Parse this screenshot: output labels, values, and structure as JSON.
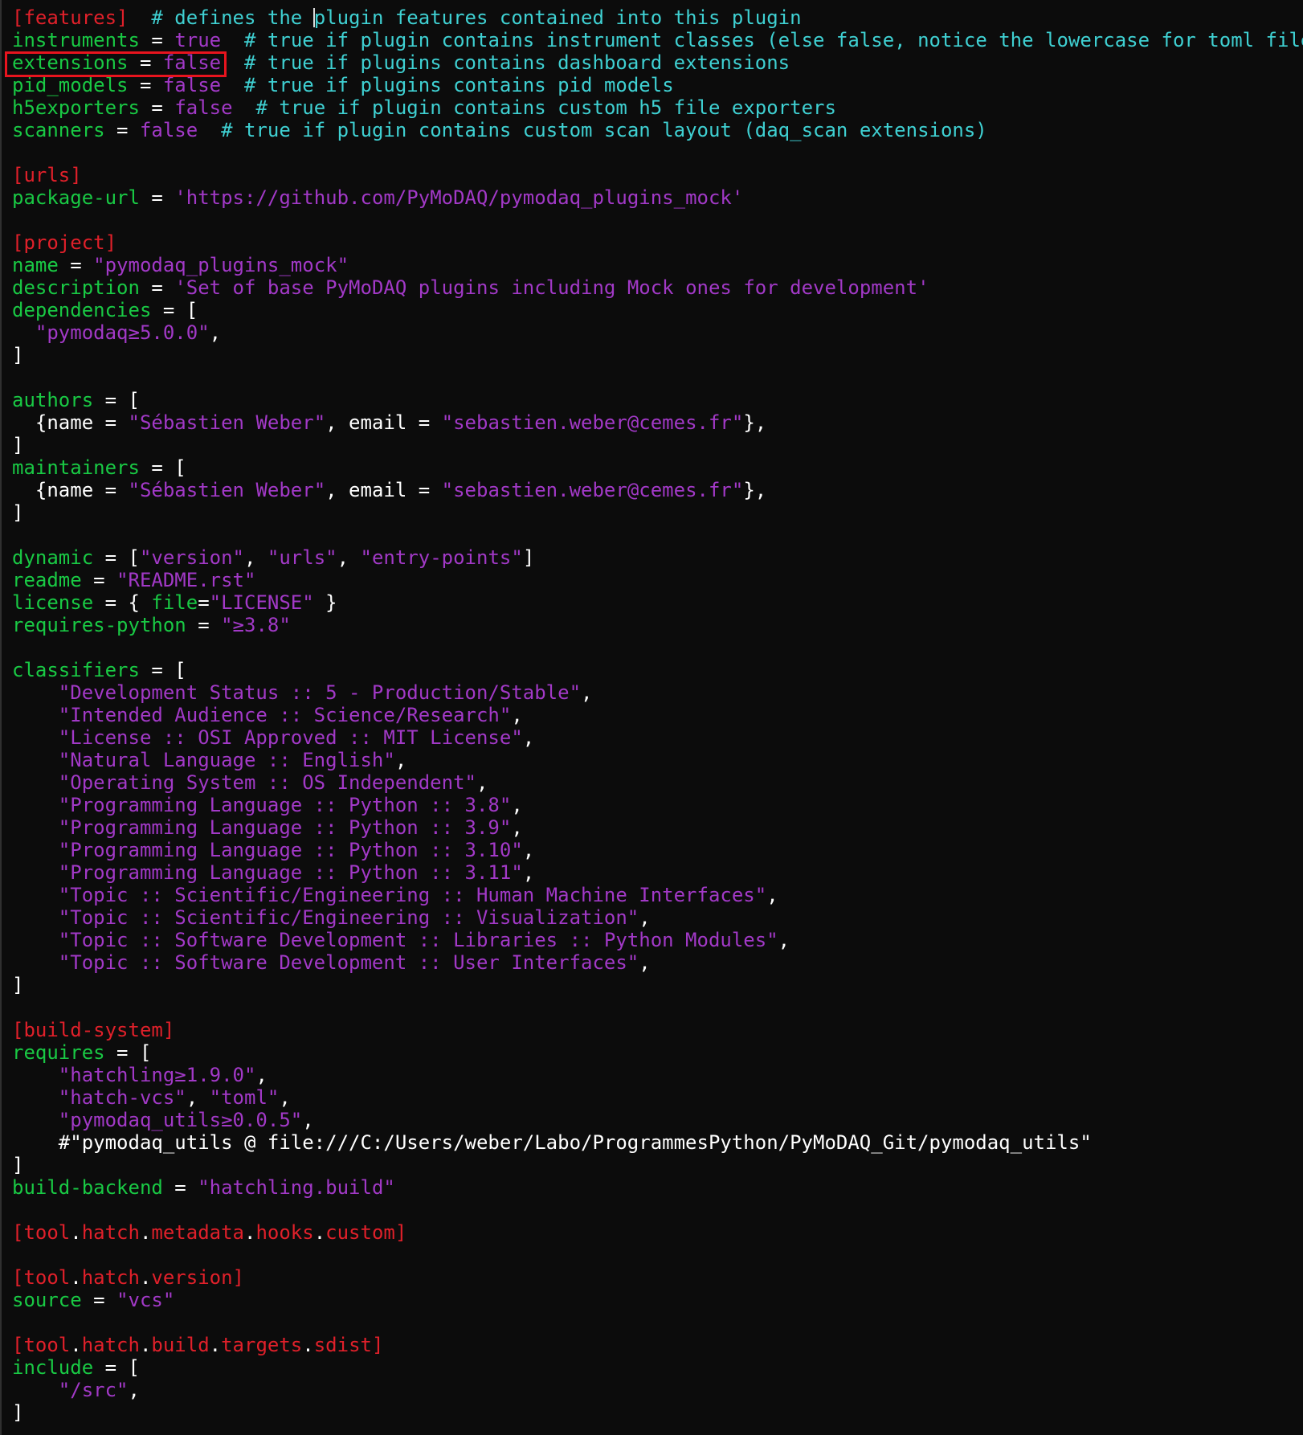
{
  "colors": {
    "background": "#0c0c0c",
    "section": "#e0202a",
    "key": "#19c944",
    "string": "#a239c7",
    "comment": "#3fd0d2",
    "punctuation": "#ffffff",
    "highlight_box": "#e8141e"
  },
  "lines": [
    [
      {
        "t": "[features]",
        "c": "section"
      },
      {
        "t": "  ",
        "c": "punc"
      },
      {
        "t": "# defines the ",
        "c": "comment"
      },
      {
        "cursor": true
      },
      {
        "t": "plugin features contained into this plugin",
        "c": "comment"
      }
    ],
    [
      {
        "t": "instruments",
        "c": "key"
      },
      {
        "t": " = ",
        "c": "punc"
      },
      {
        "t": "true",
        "c": "str"
      },
      {
        "t": "  ",
        "c": "punc"
      },
      {
        "t": "# true if plugin contains instrument classes (else false, notice the lowercase for toml files)",
        "c": "comment"
      }
    ],
    [
      {
        "t": "extensions",
        "c": "key"
      },
      {
        "t": " = ",
        "c": "punc"
      },
      {
        "t": "false",
        "c": "str"
      },
      {
        "t": "  ",
        "c": "punc"
      },
      {
        "t": "# true if plugins contains dashboard extensions",
        "c": "comment"
      }
    ],
    [
      {
        "t": "pid_models",
        "c": "key"
      },
      {
        "t": " = ",
        "c": "punc"
      },
      {
        "t": "false",
        "c": "str"
      },
      {
        "t": "  ",
        "c": "punc"
      },
      {
        "t": "# true if plugins contains pid models",
        "c": "comment"
      }
    ],
    [
      {
        "t": "h5exporters",
        "c": "key"
      },
      {
        "t": " = ",
        "c": "punc"
      },
      {
        "t": "false",
        "c": "str"
      },
      {
        "t": "  ",
        "c": "punc"
      },
      {
        "t": "# true if plugin contains custom h5 file exporters",
        "c": "comment"
      }
    ],
    [
      {
        "t": "scanners",
        "c": "key"
      },
      {
        "t": " = ",
        "c": "punc"
      },
      {
        "t": "false",
        "c": "str"
      },
      {
        "t": "  ",
        "c": "punc"
      },
      {
        "t": "# true if plugin contains custom scan layout (daq_scan extensions)",
        "c": "comment"
      }
    ],
    [],
    [
      {
        "t": "[urls]",
        "c": "section"
      }
    ],
    [
      {
        "t": "package-url",
        "c": "key"
      },
      {
        "t": " = ",
        "c": "punc"
      },
      {
        "t": "'https://github.com/PyMoDAQ/pymodaq_plugins_mock'",
        "c": "str"
      }
    ],
    [],
    [
      {
        "t": "[project]",
        "c": "section"
      }
    ],
    [
      {
        "t": "name",
        "c": "key"
      },
      {
        "t": " = ",
        "c": "punc"
      },
      {
        "t": "\"pymodaq_plugins_mock\"",
        "c": "str"
      }
    ],
    [
      {
        "t": "description",
        "c": "key"
      },
      {
        "t": " = ",
        "c": "punc"
      },
      {
        "t": "'Set of base PyMoDAQ plugins including Mock ones for development'",
        "c": "str"
      }
    ],
    [
      {
        "t": "dependencies",
        "c": "key"
      },
      {
        "t": " = [",
        "c": "punc"
      }
    ],
    [
      {
        "t": "  ",
        "c": "punc"
      },
      {
        "t": "\"pymodaq≥5.0.0\"",
        "c": "str"
      },
      {
        "t": ",",
        "c": "punc"
      }
    ],
    [
      {
        "t": "]",
        "c": "punc"
      }
    ],
    [],
    [
      {
        "t": "authors",
        "c": "key"
      },
      {
        "t": " = [",
        "c": "punc"
      }
    ],
    [
      {
        "t": "  {name = ",
        "c": "punc"
      },
      {
        "t": "\"Sébastien Weber\"",
        "c": "str"
      },
      {
        "t": ", email = ",
        "c": "punc"
      },
      {
        "t": "\"sebastien.weber@cemes.fr\"",
        "c": "str"
      },
      {
        "t": "},",
        "c": "punc"
      }
    ],
    [
      {
        "t": "]",
        "c": "punc"
      }
    ],
    [
      {
        "t": "maintainers",
        "c": "key"
      },
      {
        "t": " = [",
        "c": "punc"
      }
    ],
    [
      {
        "t": "  {name = ",
        "c": "punc"
      },
      {
        "t": "\"Sébastien Weber\"",
        "c": "str"
      },
      {
        "t": ", email = ",
        "c": "punc"
      },
      {
        "t": "\"sebastien.weber@cemes.fr\"",
        "c": "str"
      },
      {
        "t": "},",
        "c": "punc"
      }
    ],
    [
      {
        "t": "]",
        "c": "punc"
      }
    ],
    [],
    [
      {
        "t": "dynamic",
        "c": "key"
      },
      {
        "t": " = [",
        "c": "punc"
      },
      {
        "t": "\"version\"",
        "c": "str"
      },
      {
        "t": ", ",
        "c": "punc"
      },
      {
        "t": "\"urls\"",
        "c": "str"
      },
      {
        "t": ", ",
        "c": "punc"
      },
      {
        "t": "\"entry-points\"",
        "c": "str"
      },
      {
        "t": "]",
        "c": "punc"
      }
    ],
    [
      {
        "t": "readme",
        "c": "key"
      },
      {
        "t": " = ",
        "c": "punc"
      },
      {
        "t": "\"README.rst\"",
        "c": "str"
      }
    ],
    [
      {
        "t": "license",
        "c": "key"
      },
      {
        "t": " = { ",
        "c": "punc"
      },
      {
        "t": "file",
        "c": "key"
      },
      {
        "t": "=",
        "c": "punc"
      },
      {
        "t": "\"LICENSE\"",
        "c": "str"
      },
      {
        "t": " }",
        "c": "punc"
      }
    ],
    [
      {
        "t": "requires-python",
        "c": "key"
      },
      {
        "t": " = ",
        "c": "punc"
      },
      {
        "t": "\"≥3.8\"",
        "c": "str"
      }
    ],
    [],
    [
      {
        "t": "classifiers",
        "c": "key"
      },
      {
        "t": " = [",
        "c": "punc"
      }
    ],
    [
      {
        "t": "    ",
        "c": "punc"
      },
      {
        "t": "\"Development Status :: 5 - Production/Stable\"",
        "c": "str"
      },
      {
        "t": ",",
        "c": "punc"
      }
    ],
    [
      {
        "t": "    ",
        "c": "punc"
      },
      {
        "t": "\"Intended Audience :: Science/Research\"",
        "c": "str"
      },
      {
        "t": ",",
        "c": "punc"
      }
    ],
    [
      {
        "t": "    ",
        "c": "punc"
      },
      {
        "t": "\"License :: OSI Approved :: MIT License\"",
        "c": "str"
      },
      {
        "t": ",",
        "c": "punc"
      }
    ],
    [
      {
        "t": "    ",
        "c": "punc"
      },
      {
        "t": "\"Natural Language :: English\"",
        "c": "str"
      },
      {
        "t": ",",
        "c": "punc"
      }
    ],
    [
      {
        "t": "    ",
        "c": "punc"
      },
      {
        "t": "\"Operating System :: OS Independent\"",
        "c": "str"
      },
      {
        "t": ",",
        "c": "punc"
      }
    ],
    [
      {
        "t": "    ",
        "c": "punc"
      },
      {
        "t": "\"Programming Language :: Python :: 3.8\"",
        "c": "str"
      },
      {
        "t": ",",
        "c": "punc"
      }
    ],
    [
      {
        "t": "    ",
        "c": "punc"
      },
      {
        "t": "\"Programming Language :: Python :: 3.9\"",
        "c": "str"
      },
      {
        "t": ",",
        "c": "punc"
      }
    ],
    [
      {
        "t": "    ",
        "c": "punc"
      },
      {
        "t": "\"Programming Language :: Python :: 3.10\"",
        "c": "str"
      },
      {
        "t": ",",
        "c": "punc"
      }
    ],
    [
      {
        "t": "    ",
        "c": "punc"
      },
      {
        "t": "\"Programming Language :: Python :: 3.11\"",
        "c": "str"
      },
      {
        "t": ",",
        "c": "punc"
      }
    ],
    [
      {
        "t": "    ",
        "c": "punc"
      },
      {
        "t": "\"Topic :: Scientific/Engineering :: Human Machine Interfaces\"",
        "c": "str"
      },
      {
        "t": ",",
        "c": "punc"
      }
    ],
    [
      {
        "t": "    ",
        "c": "punc"
      },
      {
        "t": "\"Topic :: Scientific/Engineering :: Visualization\"",
        "c": "str"
      },
      {
        "t": ",",
        "c": "punc"
      }
    ],
    [
      {
        "t": "    ",
        "c": "punc"
      },
      {
        "t": "\"Topic :: Software Development :: Libraries :: Python Modules\"",
        "c": "str"
      },
      {
        "t": ",",
        "c": "punc"
      }
    ],
    [
      {
        "t": "    ",
        "c": "punc"
      },
      {
        "t": "\"Topic :: Software Development :: User Interfaces\"",
        "c": "str"
      },
      {
        "t": ",",
        "c": "punc"
      }
    ],
    [
      {
        "t": "]",
        "c": "punc"
      }
    ],
    [],
    [
      {
        "t": "[build-system]",
        "c": "section"
      }
    ],
    [
      {
        "t": "requires",
        "c": "key"
      },
      {
        "t": " = [",
        "c": "punc"
      }
    ],
    [
      {
        "t": "    ",
        "c": "punc"
      },
      {
        "t": "\"hatchling≥1.9.0\"",
        "c": "str"
      },
      {
        "t": ",",
        "c": "punc"
      }
    ],
    [
      {
        "t": "    ",
        "c": "punc"
      },
      {
        "t": "\"hatch-vcs\"",
        "c": "str"
      },
      {
        "t": ", ",
        "c": "punc"
      },
      {
        "t": "\"toml\"",
        "c": "str"
      },
      {
        "t": ",",
        "c": "punc"
      }
    ],
    [
      {
        "t": "    ",
        "c": "punc"
      },
      {
        "t": "\"pymodaq_utils≥0.0.5\"",
        "c": "str"
      },
      {
        "t": ",",
        "c": "punc"
      }
    ],
    [
      {
        "t": "    #\"pymodaq_utils @ file:///C:/Users/weber/Labo/ProgrammesPython/PyMoDAQ_Git/pymodaq_utils\"",
        "c": "punc"
      }
    ],
    [
      {
        "t": "]",
        "c": "punc"
      }
    ],
    [
      {
        "t": "build-backend",
        "c": "key"
      },
      {
        "t": " = ",
        "c": "punc"
      },
      {
        "t": "\"hatchling.build\"",
        "c": "str"
      }
    ],
    [],
    [
      {
        "t": "[tool",
        "c": "section"
      },
      {
        "t": ".",
        "c": "punc"
      },
      {
        "t": "hatch",
        "c": "section"
      },
      {
        "t": ".",
        "c": "punc"
      },
      {
        "t": "metadata",
        "c": "section"
      },
      {
        "t": ".",
        "c": "punc"
      },
      {
        "t": "hooks",
        "c": "section"
      },
      {
        "t": ".",
        "c": "punc"
      },
      {
        "t": "custom]",
        "c": "section"
      }
    ],
    [],
    [
      {
        "t": "[tool",
        "c": "section"
      },
      {
        "t": ".",
        "c": "punc"
      },
      {
        "t": "hatch",
        "c": "section"
      },
      {
        "t": ".",
        "c": "punc"
      },
      {
        "t": "version]",
        "c": "section"
      }
    ],
    [
      {
        "t": "source",
        "c": "key"
      },
      {
        "t": " = ",
        "c": "punc"
      },
      {
        "t": "\"vcs\"",
        "c": "str"
      }
    ],
    [],
    [
      {
        "t": "[tool",
        "c": "section"
      },
      {
        "t": ".",
        "c": "punc"
      },
      {
        "t": "hatch",
        "c": "section"
      },
      {
        "t": ".",
        "c": "punc"
      },
      {
        "t": "build",
        "c": "section"
      },
      {
        "t": ".",
        "c": "punc"
      },
      {
        "t": "targets",
        "c": "section"
      },
      {
        "t": ".",
        "c": "punc"
      },
      {
        "t": "sdist]",
        "c": "section"
      }
    ],
    [
      {
        "t": "include",
        "c": "key"
      },
      {
        "t": " = [",
        "c": "punc"
      }
    ],
    [
      {
        "t": "    ",
        "c": "punc"
      },
      {
        "t": "\"/src\"",
        "c": "str"
      },
      {
        "t": ",",
        "c": "punc"
      }
    ],
    [
      {
        "t": "]",
        "c": "punc"
      }
    ]
  ]
}
